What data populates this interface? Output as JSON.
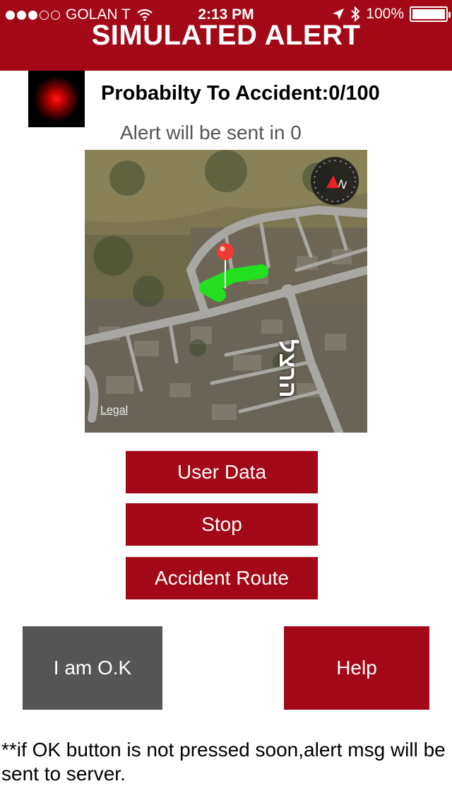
{
  "status_bar": {
    "carrier": "GOLAN T",
    "time": "2:13 PM",
    "battery": "100%",
    "signal_icon": "signal-dots-icon",
    "wifi_icon": "wifi-icon",
    "location_icon": "location-arrow-icon",
    "bluetooth_icon": "bluetooth-icon",
    "battery_icon": "battery-icon"
  },
  "header": {
    "title": "SIMULATED ALERT"
  },
  "alert": {
    "probability": "Probabilty To Accident:0/100",
    "countdown": "Alert will be sent in 0",
    "indicator_color": "#ff0000"
  },
  "map": {
    "legal": "Legal",
    "street_label": "הרצל",
    "compass_label": "N",
    "pin_color": "#ee3a32",
    "route_color": "#22e01e"
  },
  "buttons": {
    "user_data": "User Data",
    "stop": "Stop",
    "accident_route": "Accident Route",
    "ok": "I am O.K",
    "help": "Help"
  },
  "footer": {
    "note": "**if OK button is not pressed soon,alert msg will be sent  to server."
  },
  "colors": {
    "brand": "#a30816",
    "ok_button": "#555555"
  }
}
